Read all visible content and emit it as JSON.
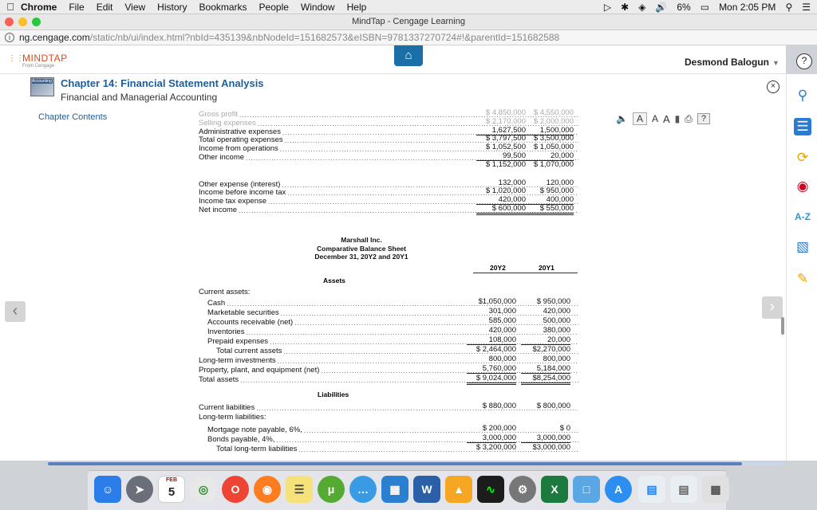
{
  "menubar": {
    "apple": "",
    "items": [
      "Chrome",
      "File",
      "Edit",
      "View",
      "History",
      "Bookmarks",
      "People",
      "Window",
      "Help"
    ],
    "battery": "6%",
    "clock": "Mon 2:05 PM"
  },
  "window": {
    "title": "MindTap - Cengage Learning"
  },
  "address": {
    "host": "ng.cengage.com",
    "path": "/static/nb/ui/index.html?nbId=435139&nbNodeId=151682573&eISBN=9781337270724#!&parentId=151682588"
  },
  "header": {
    "logo": "MINDTAP",
    "logo_sub": "From Cengage",
    "user": "Desmond Balogun",
    "help": "?"
  },
  "chapter": {
    "title": "Chapter 14: Financial Statement Analysis",
    "subtitle": "Financial and Managerial Accounting",
    "book_label": "Accounting",
    "close": "×"
  },
  "sidebar": {
    "contents_link": "Chapter Contents"
  },
  "toolbar": {
    "a1": "A",
    "a2": "A",
    "a3": "A",
    "help": "?"
  },
  "income": {
    "rows": [
      {
        "label": "Gross profit",
        "y2": "$ 4,850,000",
        "y1": "$ 4,550,000"
      },
      {
        "label": "Selling expenses",
        "y2": "$ 2,170,000",
        "y1": "$ 2,000,000"
      },
      {
        "label": "Administrative expenses",
        "y2": "1,627,500",
        "y1": "1,500,000"
      },
      {
        "label": "Total operating expenses",
        "y2": "$ 3,797,500",
        "y1": "$ 3,500,000"
      },
      {
        "label": "Income from operations",
        "y2": "$ 1,052,500",
        "y1": "$ 1,050,000"
      },
      {
        "label": "Other income",
        "y2": "99,500",
        "y1": "20,000"
      },
      {
        "label": "",
        "y2": "$ 1,152,000",
        "y1": "$ 1,070,000"
      },
      {
        "label": "Other expense (interest)",
        "y2": "132,000",
        "y1": "120,000"
      },
      {
        "label": "Income before income tax",
        "y2": "$ 1,020,000",
        "y1": "$ 950,000"
      },
      {
        "label": "Income tax expense",
        "y2": "420,000",
        "y1": "400,000"
      },
      {
        "label": "Net income",
        "y2": "$ 600,000",
        "y1": "$ 550,000"
      }
    ]
  },
  "balance": {
    "company": "Marshall Inc.",
    "title": "Comparative Balance Sheet",
    "date": "December 31, 20Y2 and 20Y1",
    "col2": "20Y2",
    "col1": "20Y1",
    "assets_heading": "Assets",
    "current_assets_label": "Current assets:",
    "rows": [
      {
        "label": "Cash",
        "y2": "$1,050,000",
        "y1": "$ 950,000"
      },
      {
        "label": "Marketable securities",
        "y2": "301,000",
        "y1": "420,000"
      },
      {
        "label": "Accounts receivable (net)",
        "y2": "585,000",
        "y1": "500,000"
      },
      {
        "label": "Inventories",
        "y2": "420,000",
        "y1": "380,000"
      },
      {
        "label": "Prepaid expenses",
        "y2": "108,000",
        "y1": "20,000"
      },
      {
        "label": "Total current assets",
        "y2": "$ 2,464,000",
        "y1": "$2,270,000"
      },
      {
        "label": "Long-term investments",
        "y2": "800,000",
        "y1": "800,000"
      },
      {
        "label": "Property, plant, and equipment (net)",
        "y2": "5,760,000",
        "y1": "5,184,000"
      },
      {
        "label": "Total assets",
        "y2": "$ 9,024,000",
        "y1": "$8,254,000"
      }
    ],
    "liabilities_heading": "Liabilities",
    "liab_rows": [
      {
        "label": "Current liabilities",
        "y2": "$ 880,000",
        "y1": "$ 800,000"
      },
      {
        "label": "Long-term liabilities:",
        "y2": "",
        "y1": ""
      },
      {
        "label": "Mortgage note payable, 6%,",
        "y2": "$ 200,000",
        "y1": "$ 0"
      },
      {
        "label": "Bonds payable, 4%,",
        "y2": "3,000,000",
        "y1": "3,000,000"
      },
      {
        "label": "Total long-term liabilities",
        "y2": "$ 3,200,000",
        "y1": "$3,000,000"
      }
    ]
  },
  "dock": {
    "calendar_month": "FEB",
    "calendar_day": "5"
  },
  "colors": {
    "brand_blue": "#1f5d96",
    "mindtap_orange": "#d94a1e",
    "home_blue": "#1b6fa8"
  }
}
